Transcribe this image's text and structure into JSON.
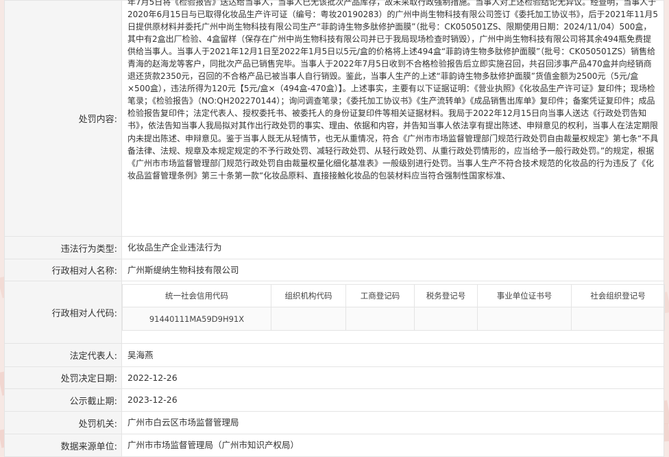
{
  "record": {
    "content_label": "处罚内容:",
    "content_text": "年7月5日将《检验报告》送达给当事人，当事人已无该批次产品库存，故未采取行政强制措施。当事人对上述检验结论无异议。经查明，当事人于2020年6月15日与已取得化妆品生产许可证（编号：粤妆20190283）的广州中尚生物科技有限公司签订《委托加工协议书》，后于2021年11月5日提供原材料并委托广州中尚生物科技有限公司生产“菲韵诗生物多肽修护面膜”（批号：CK050501ZS、限期使用日期：2024/11/04）500盒，其中有2盒出厂检验、4盒留样（保存在广州中尚生物科技有限公司并已于我局现场检查时销毁），广州中尚生物科技有限公司将其余494瓶免费提供给当事人。当事人于2021年12月1日至2022年1月5日以5元/盒的价格将上述494盒“菲韵诗生物多肽修护面膜”（批号：CK050501ZS）销售给青海的赵海龙等客户，同批次产品已销售完毕。当事人于2022年7月5日收到不合格检验报告后立即实施召回，共召回涉事产品470盒并向经销商退还货款2350元，召回的不合格产品已被当事人自行销毁。鉴此，当事人生产的上述“菲韵诗生物多肽修护面膜”货值金额为2500元（5元/盒×500盒），违法所得为120元【5元/盒×（494盒-470盒）】。上述事实，主要有以下证据证明：《营业执照》《化妆品生产许可证》复印件；现场检笔录；《检验报告》（NO:QH202270144）；询问调查笔录；《委托加工协议书》《生产流转单》《成品销售出库单》复印件；备案凭证复印件；成品检验报告复印件；法定代表人、授权委托书、被委托人的身份证复印件等相关证据材料。我局于2022年12月15日向当事人送达《行政处罚告知书》，依法告知当事人我局拟对其作出行政处罚的事实、理由、依据和内容，并告知当事人依法享有提出陈述、申辩意见的权利，当事人在法定期限内未提出陈述、申辩意见。鉴于当事人既无从轻情节，也无从重情况，符合《广州市市场监督管理部门规范行政处罚自由裁量权规定》第七条“不具备法律、法规、规章及本规定规定的不予行政处罚、减轻行政处罚、从轻行政处罚、从重行政处罚情形的，应当给予一般行政处罚。”的规定，根据《广州市市场监督管理部门规范行政处罚自由裁量权量化细化基准表》一般级别进行处罚。当事人生产不符合技术规范的化妆品的行为违反了《化妆品监督管理条例》第三十条第一款“化妆品原料、直接接触化妆品的包装材料应当符合强制性国家标准、",
    "violation_type_label": "违法行为类型:",
    "violation_type": "化妆品生产企业违法行为",
    "party_name_label": "行政相对人名称:",
    "party_name": "广州斯缇纳生物科技有限公司",
    "party_code_label": "行政相对人代码:",
    "code_headers": [
      "统一社会信用代码",
      "组织机构代码",
      "工商登记码",
      "税务登记号",
      "事业单位证书号",
      "社会组织登记号"
    ],
    "code_values": [
      "91440111MA59D9H91X",
      "",
      "",
      "",
      "",
      ""
    ],
    "legal_rep_label": "法定代表人:",
    "legal_rep": "吴海燕",
    "decision_date_label": "处罚决定日期:",
    "decision_date": "2022-12-26",
    "publish_deadline_label": "公示截止期:",
    "publish_deadline": "2023-12-26",
    "authority_label": "处罚机关:",
    "authority": "广州市白云区市场监督管理局",
    "source_label": "数据来源单位:",
    "source": "广州市市场监督管理局（广州市知识产权局）"
  }
}
